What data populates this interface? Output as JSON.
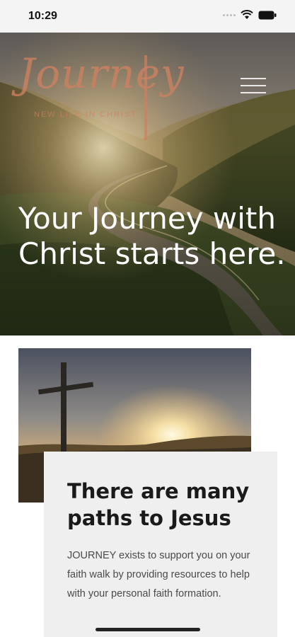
{
  "status_bar": {
    "time": "10:29",
    "icons": [
      "signal-icon",
      "wifi-icon",
      "battery-icon"
    ]
  },
  "hero": {
    "logo_text": "Journey",
    "logo_subtitle": "NEW LIFE IN CHRIST",
    "menu_icon": "hamburger-menu-icon",
    "headline": "Your Journey with Christ starts here."
  },
  "intro_card": {
    "image_icon": "cross-at-sunset-image",
    "title": "There are many paths to Jesus",
    "body": "JOURNEY exists to support you on your faith walk by providing resources to help with your personal faith formation."
  },
  "colors": {
    "logo_accent": "#ce8060",
    "card_background": "#efefef",
    "hero_text": "#ffffff"
  }
}
